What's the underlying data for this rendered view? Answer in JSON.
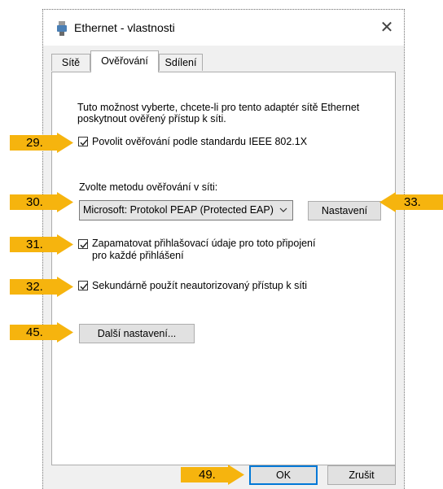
{
  "window": {
    "title": "Ethernet - vlastnosti",
    "close_symbol": "✕"
  },
  "tabs": [
    {
      "label": "Sítě",
      "active": false
    },
    {
      "label": "Ověřování",
      "active": true
    },
    {
      "label": "Sdílení",
      "active": false
    }
  ],
  "auth": {
    "description": "Tuto možnost vyberte, chcete-li pro tento adaptér sítě Ethernet poskytnout ověřený přístup k síti.",
    "enable_8021x": {
      "label": "Povolit ověřování podle standardu IEEE 802.1X",
      "checked": true
    },
    "method_label": "Zvolte metodu ověřování v síti:",
    "method_value": "Microsoft: Protokol PEAP (Protected EAP)",
    "settings_button": "Nastavení",
    "remember_credentials": {
      "label_line1": "Zapamatovat přihlašovací údaje pro toto připojení",
      "label_line2": "pro každé přihlášení",
      "checked": true
    },
    "fallback_unauthorized": {
      "label": "Sekundárně použít neautorizovaný přístup k síti",
      "checked": true
    },
    "additional_settings_button": "Další nastavení..."
  },
  "footer": {
    "ok_label": "OK",
    "cancel_label": "Zrušit"
  },
  "callouts": {
    "c29": "29.",
    "c30": "30.",
    "c31": "31.",
    "c32": "32.",
    "c33": "33.",
    "c45": "45.",
    "c49": "49."
  },
  "colors": {
    "callout": "#f6b40e",
    "accent": "#0078d7"
  },
  "icons": {
    "title": "ethernet-adapter-icon",
    "close": "close-icon",
    "checkbox": "checkmark-icon",
    "dropdown": "chevron-down-icon"
  }
}
